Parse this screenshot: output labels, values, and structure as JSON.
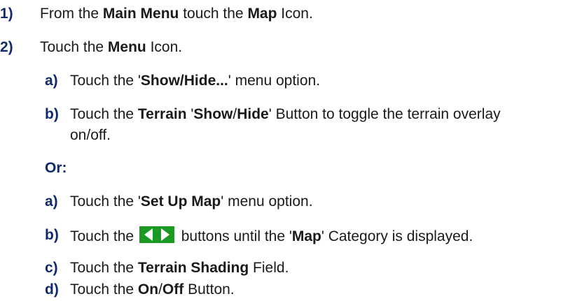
{
  "steps": [
    {
      "marker": "1)",
      "parts": [
        "From the ",
        "Main Menu",
        " touch the ",
        "Map",
        " Icon."
      ]
    },
    {
      "marker": "2)",
      "parts": [
        "Touch the ",
        "Menu",
        " Icon."
      ]
    }
  ],
  "sub_a1": {
    "marker": "a)",
    "parts": [
      "Touch the '",
      "Show/Hide...",
      "' menu option."
    ]
  },
  "sub_b1": {
    "marker": "b)",
    "line1_parts": [
      "Touch the ",
      "Terrain",
      " '",
      "Show",
      "/",
      "Hide",
      "' Button to toggle the terrain overlay"
    ],
    "line2": "on/off."
  },
  "or_label": "Or:",
  "sub_a2": {
    "marker": "a)",
    "parts": [
      "Touch the '",
      "Set Up Map",
      "' menu option."
    ]
  },
  "sub_b2": {
    "marker": "b)",
    "before": "Touch the ",
    "after_parts": [
      " buttons until the '",
      "Map",
      "' Category is displayed."
    ],
    "icon": "left-right-arrow-buttons-icon",
    "icon_color": "#1a9a22"
  },
  "sub_c2": {
    "marker": "c)",
    "parts": [
      "Touch the ",
      "Terrain Shading",
      " Field."
    ]
  },
  "sub_d2": {
    "marker": "d)",
    "parts": [
      "Touch the ",
      "On",
      "/",
      "Off",
      " Button."
    ]
  },
  "colors": {
    "marker": "#0f2b6b",
    "text": "#1a1a1a"
  }
}
